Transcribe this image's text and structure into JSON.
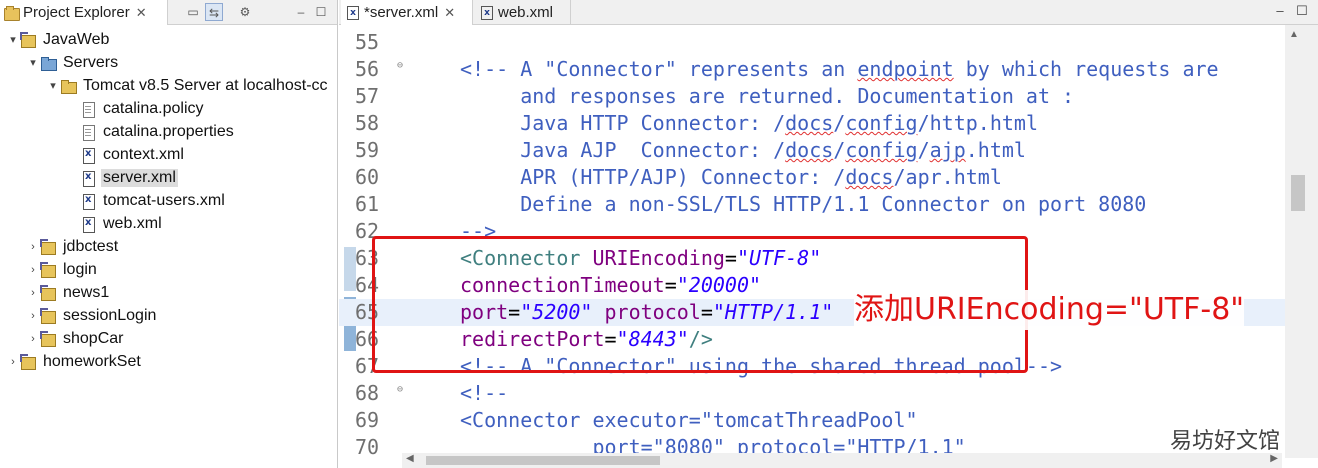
{
  "explorer": {
    "tab_title": "Project Explorer",
    "tab_close": "✕",
    "tree": [
      {
        "label": "JavaWeb",
        "indent": 0,
        "arrow": "▾",
        "icon": "project-icon"
      },
      {
        "label": "Servers",
        "indent": 1,
        "arrow": "▾",
        "icon": "servers-folder-icon"
      },
      {
        "label": "Tomcat v8.5 Server at localhost-cc",
        "indent": 2,
        "arrow": "▾",
        "icon": "folder-icon"
      },
      {
        "label": "catalina.policy",
        "indent": 3,
        "arrow": "",
        "icon": "file-icon"
      },
      {
        "label": "catalina.properties",
        "indent": 3,
        "arrow": "",
        "icon": "file-icon"
      },
      {
        "label": "context.xml",
        "indent": 3,
        "arrow": "",
        "icon": "xml-file-icon"
      },
      {
        "label": "server.xml",
        "indent": 3,
        "arrow": "",
        "icon": "xml-file-icon",
        "selected": true
      },
      {
        "label": "tomcat-users.xml",
        "indent": 3,
        "arrow": "",
        "icon": "xml-file-icon"
      },
      {
        "label": "web.xml",
        "indent": 3,
        "arrow": "",
        "icon": "xml-file-icon"
      },
      {
        "label": "jdbctest",
        "indent": 1,
        "arrow": "›",
        "icon": "project-icon"
      },
      {
        "label": "login",
        "indent": 1,
        "arrow": "›",
        "icon": "project-icon"
      },
      {
        "label": "news1",
        "indent": 1,
        "arrow": "›",
        "icon": "project-icon"
      },
      {
        "label": "sessionLogin",
        "indent": 1,
        "arrow": "›",
        "icon": "project-icon"
      },
      {
        "label": "shopCar",
        "indent": 1,
        "arrow": "›",
        "icon": "project-icon"
      },
      {
        "label": "homeworkSet",
        "indent": 0,
        "arrow": "›",
        "icon": "project-icon"
      }
    ]
  },
  "editor": {
    "tabs": [
      {
        "label": "*server.xml",
        "close": "✕",
        "active": true
      },
      {
        "label": "web.xml",
        "close": "",
        "active": false
      }
    ],
    "fold_marker": "⊖",
    "lines": [
      {
        "num": "55",
        "segs": []
      },
      {
        "num": "56",
        "fold": true,
        "segs": [
          [
            "c-comment",
            "<!-- A \"Connector\" represents an "
          ],
          [
            "c-comment sp",
            "endpoint"
          ],
          [
            "c-comment",
            " by which requests are"
          ]
        ]
      },
      {
        "num": "57",
        "segs": [
          [
            "c-comment",
            "     and responses are returned. Documentation at :"
          ]
        ]
      },
      {
        "num": "58",
        "segs": [
          [
            "c-comment",
            "     Java HTTP Connector: /"
          ],
          [
            "c-comment sp",
            "docs"
          ],
          [
            "c-comment",
            "/"
          ],
          [
            "c-comment sp",
            "config"
          ],
          [
            "c-comment",
            "/http.html"
          ]
        ]
      },
      {
        "num": "59",
        "segs": [
          [
            "c-comment",
            "     Java AJP  Connector: /"
          ],
          [
            "c-comment sp",
            "docs"
          ],
          [
            "c-comment",
            "/"
          ],
          [
            "c-comment sp",
            "config"
          ],
          [
            "c-comment",
            "/"
          ],
          [
            "c-comment sp",
            "ajp"
          ],
          [
            "c-comment",
            ".html"
          ]
        ]
      },
      {
        "num": "60",
        "segs": [
          [
            "c-comment",
            "     APR (HTTP/AJP) Connector: /"
          ],
          [
            "c-comment sp",
            "docs"
          ],
          [
            "c-comment",
            "/apr.html"
          ]
        ]
      },
      {
        "num": "61",
        "segs": [
          [
            "c-comment",
            "     Define a non-SSL/TLS HTTP/1.1 Connector on port 8080"
          ]
        ]
      },
      {
        "num": "62",
        "segs": [
          [
            "c-comment",
            "-->"
          ]
        ]
      },
      {
        "num": "63",
        "segs": [
          [
            "c-tag",
            "<Connector "
          ],
          [
            "c-attr",
            "URIEncoding"
          ],
          [
            "c-plain",
            "="
          ],
          [
            "c-val",
            "\"UTF-8\""
          ]
        ]
      },
      {
        "num": "64",
        "segs": [
          [
            "c-attr",
            "connectionTimeout"
          ],
          [
            "c-plain",
            "="
          ],
          [
            "c-val",
            "\"20000\""
          ]
        ]
      },
      {
        "num": "65",
        "hl": true,
        "segs": [
          [
            "c-attr",
            "port"
          ],
          [
            "c-plain",
            "="
          ],
          [
            "c-val",
            "\"5200\""
          ],
          [
            "c-plain",
            " "
          ],
          [
            "c-attr",
            "protocol"
          ],
          [
            "c-plain",
            "="
          ],
          [
            "c-val",
            "\"HTTP/1.1\""
          ]
        ]
      },
      {
        "num": "66",
        "segs": [
          [
            "c-attr",
            "redirectPort"
          ],
          [
            "c-plain",
            "="
          ],
          [
            "c-val",
            "\"8443\""
          ],
          [
            "c-tag",
            "/>"
          ]
        ]
      },
      {
        "num": "67",
        "segs": [
          [
            "c-comment",
            "<!-- A \"Connector\" using the shared thread pool-->"
          ]
        ]
      },
      {
        "num": "68",
        "fold": true,
        "segs": [
          [
            "c-comment",
            "<!--"
          ]
        ]
      },
      {
        "num": "69",
        "segs": [
          [
            "c-comment",
            "<Connector executor=\"tomcatThreadPool\""
          ]
        ]
      },
      {
        "num": "70",
        "segs": [
          [
            "c-comment",
            "           port=\"8080\" protocol=\"HTTP/1.1\""
          ]
        ]
      }
    ]
  },
  "annotation": {
    "text": "添加URIEncoding=\"UTF-8\"",
    "color": "#e01414"
  },
  "watermark": "易坊好文馆"
}
